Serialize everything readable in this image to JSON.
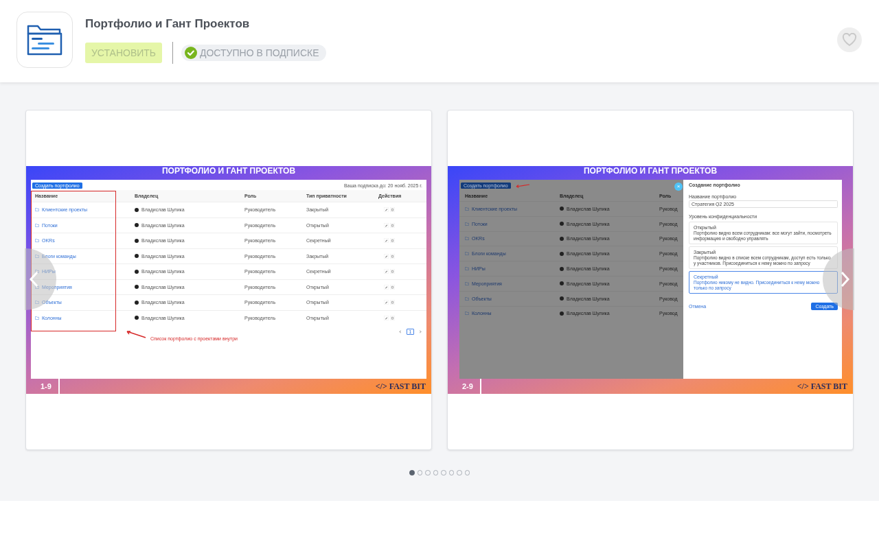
{
  "app": {
    "title": "Портфолио и Гант Проектов",
    "install_label": "УСТАНОВИТЬ",
    "install_disabled": true,
    "subscription_badge": "ДОСТУПНО В ПОДПИСКЕ",
    "favorite": false
  },
  "slides": [
    {
      "kind": "list",
      "banner": "ПОРТФОЛИО И ГАНТ ПРОЕКТОВ",
      "create_button": "Создать портфолио",
      "subscription_note": "Ваша подписка до: 20 нояб. 2025 г.",
      "columns": [
        "Название",
        "Владелец",
        "Роль",
        "Тип приватности",
        "Действия"
      ],
      "rows": [
        {
          "name": "Клиентские проекты",
          "owner": "Владислав Шулика",
          "role": "Руководитель",
          "privacy": "Закрытый"
        },
        {
          "name": "Потоки",
          "owner": "Владислав Шулика",
          "role": "Руководитель",
          "privacy": "Открытый"
        },
        {
          "name": "OKRs",
          "owner": "Владислав Шулика",
          "role": "Руководитель",
          "privacy": "Секретный"
        },
        {
          "name": "Блоги команды",
          "owner": "Владислав Шулика",
          "role": "Руководитель",
          "privacy": "Закрытый"
        },
        {
          "name": "НИРы",
          "owner": "Владислав Шулика",
          "role": "Руководитель",
          "privacy": "Секретный"
        },
        {
          "name": "Мероприятия",
          "owner": "Владислав Шулика",
          "role": "Руководитель",
          "privacy": "Открытый"
        },
        {
          "name": "Объекты",
          "owner": "Владислав Шулика",
          "role": "Руководитель",
          "privacy": "Открытый"
        },
        {
          "name": "Колонны",
          "owner": "Владислав Шулика",
          "role": "Руководитель",
          "privacy": "Открытый"
        }
      ],
      "page": "1",
      "annotation": "Список портфолио с проектами внутри",
      "number": "1-9",
      "brand": "</> FAST BIT"
    },
    {
      "kind": "modal",
      "banner": "ПОРТФОЛИО И ГАНТ ПРОЕКТОВ",
      "create_button": "Создать портфолио",
      "columns": [
        "Название",
        "Владелец",
        "Роль"
      ],
      "rows": [
        {
          "name": "Клиентские проекты",
          "owner": "Владислав Шулика",
          "role": "Руковод"
        },
        {
          "name": "Потоки",
          "owner": "Владислав Шулика",
          "role": "Руковод"
        },
        {
          "name": "OKRs",
          "owner": "Владислав Шулика",
          "role": "Руковод"
        },
        {
          "name": "Блоги команды",
          "owner": "Владислав Шулика",
          "role": "Руковод"
        },
        {
          "name": "НИРы",
          "owner": "Владислав Шулика",
          "role": "Руковод"
        },
        {
          "name": "Мероприятия",
          "owner": "Владислав Шулика",
          "role": "Руковод"
        },
        {
          "name": "Объекты",
          "owner": "Владислав Шулика",
          "role": "Руковод"
        },
        {
          "name": "Колонны",
          "owner": "Владислав Шулика",
          "role": "Руковод"
        }
      ],
      "modal": {
        "close": "×",
        "title": "Создание портфолио",
        "name_label": "Название портфолио",
        "name_value": "Стратегия Q2 2025",
        "level_label": "Уровень конфиденциальности",
        "options": [
          {
            "title": "Открытый",
            "description": "Портфолио видно всем сотрудникам: все могут зайти, посмотреть информацию и свободно управлять",
            "selected": false
          },
          {
            "title": "Закрытый",
            "description": "Портфолио видно в списке всем сотрудникам, доступ есть только у участников. Присоединиться к нему можно по запросу",
            "selected": false
          },
          {
            "title": "Секретный",
            "description": "Портфолио никому не видно. Присоединиться к нему можно только по запросу",
            "selected": true
          }
        ],
        "cancel": "Отмена",
        "submit": "Создать"
      },
      "number": "2-9",
      "brand": "</> FAST BIT"
    }
  ],
  "carousel": {
    "dots": [
      {
        "selected": true
      },
      {
        "selected": false
      },
      {
        "selected": false
      },
      {
        "selected": false
      },
      {
        "selected": false
      },
      {
        "selected": false
      },
      {
        "selected": false
      },
      {
        "selected": false
      }
    ]
  }
}
